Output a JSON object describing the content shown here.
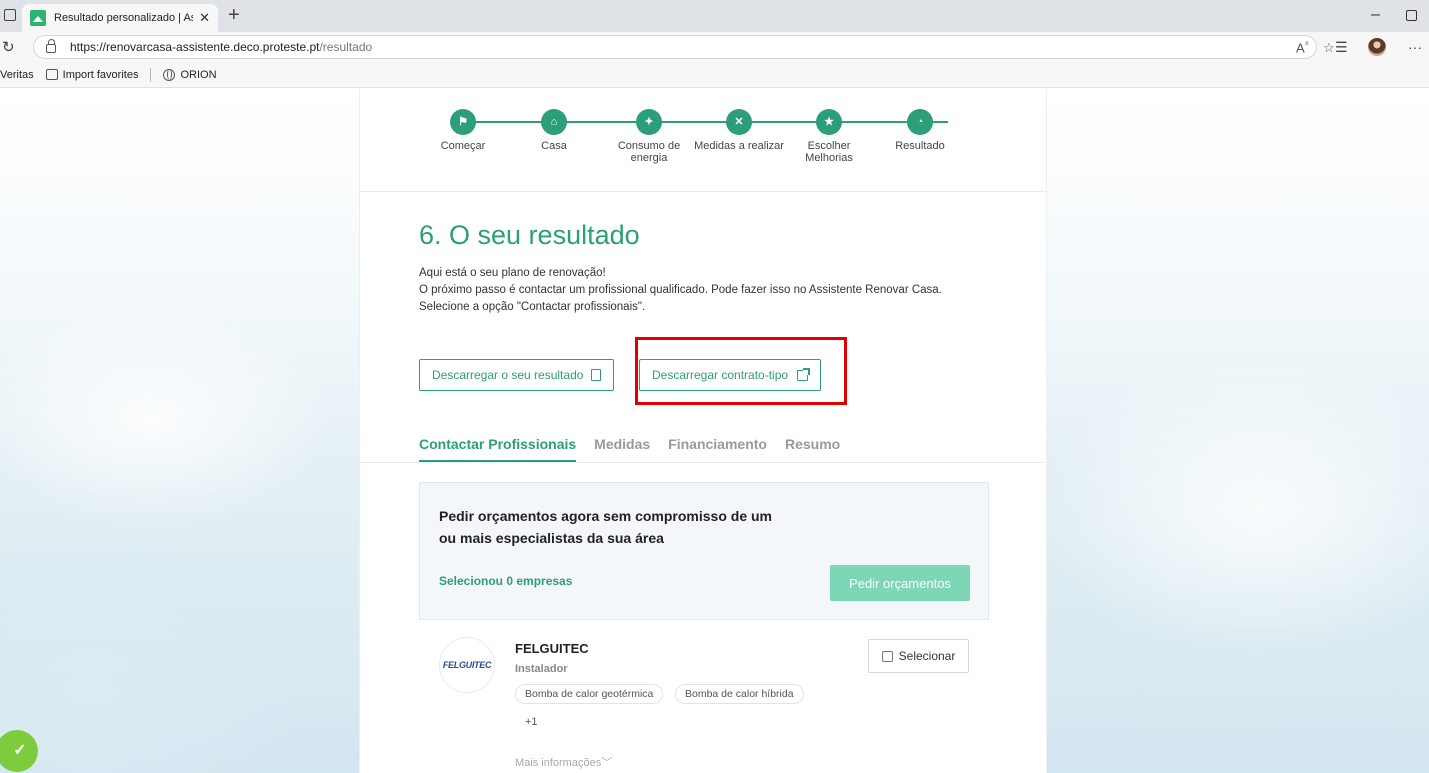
{
  "browser": {
    "tab_title": "Resultado personalizado | Assistente",
    "tab_close": "✕",
    "new_tab": "+",
    "url_host": "https://renovarcasa-assistente.deco.proteste.pt",
    "url_path": "/resultado",
    "bookmarks": [
      {
        "label": "Veritas"
      },
      {
        "label": "Import favorites"
      },
      {
        "label": "ORION"
      }
    ]
  },
  "stepper": {
    "steps": [
      {
        "label": "Começar",
        "icon": "flag-icon",
        "glyph": "⚑"
      },
      {
        "label": "Casa",
        "icon": "home-icon",
        "glyph": "⌂"
      },
      {
        "label": "Consumo de energia",
        "icon": "bulb-icon",
        "glyph": "✦"
      },
      {
        "label": "Medidas a realizar",
        "icon": "close-icon",
        "glyph": "✕"
      },
      {
        "label": "Escolher Melhorias",
        "icon": "star-icon",
        "glyph": "★"
      },
      {
        "label": "Resultado",
        "icon": "chart-icon",
        "glyph": "◔"
      }
    ],
    "accent": "#2c9e79"
  },
  "result": {
    "title": "6. O seu resultado",
    "intro_line1": "Aqui está o seu plano de renovação!",
    "intro_line2": "O próximo passo é contactar um profissional qualificado. Pode fazer isso no Assistente Renovar Casa.",
    "intro_line3": "Selecione a opção \"Contactar profissionais\".",
    "download_result_label": "Descarregar o seu resultado",
    "download_contract_label": "Descarregar contrato-tipo"
  },
  "tabs": [
    {
      "label": "Contactar Profissionais",
      "active": true
    },
    {
      "label": "Medidas",
      "active": false
    },
    {
      "label": "Financiamento",
      "active": false
    },
    {
      "label": "Resumo",
      "active": false
    }
  ],
  "quote": {
    "title": "Pedir orçamentos agora sem compromisso de um ou mais especialistas da sua área",
    "selected_text": "Selecionou 0 empresas",
    "button_label": "Pedir orçamentos",
    "button_color": "#7dd6b6"
  },
  "company": {
    "logo_text": "FELGUITEC",
    "name": "FELGUITEC",
    "type": "Instalador",
    "tags": [
      "Bomba de calor geotérmica",
      "Bomba de calor híbrida"
    ],
    "more_tags": "+1",
    "more_info": "Mais informações",
    "select_label": "Selecionar"
  },
  "badge": {
    "glyph": "✓",
    "color": "#7ecb3d"
  }
}
